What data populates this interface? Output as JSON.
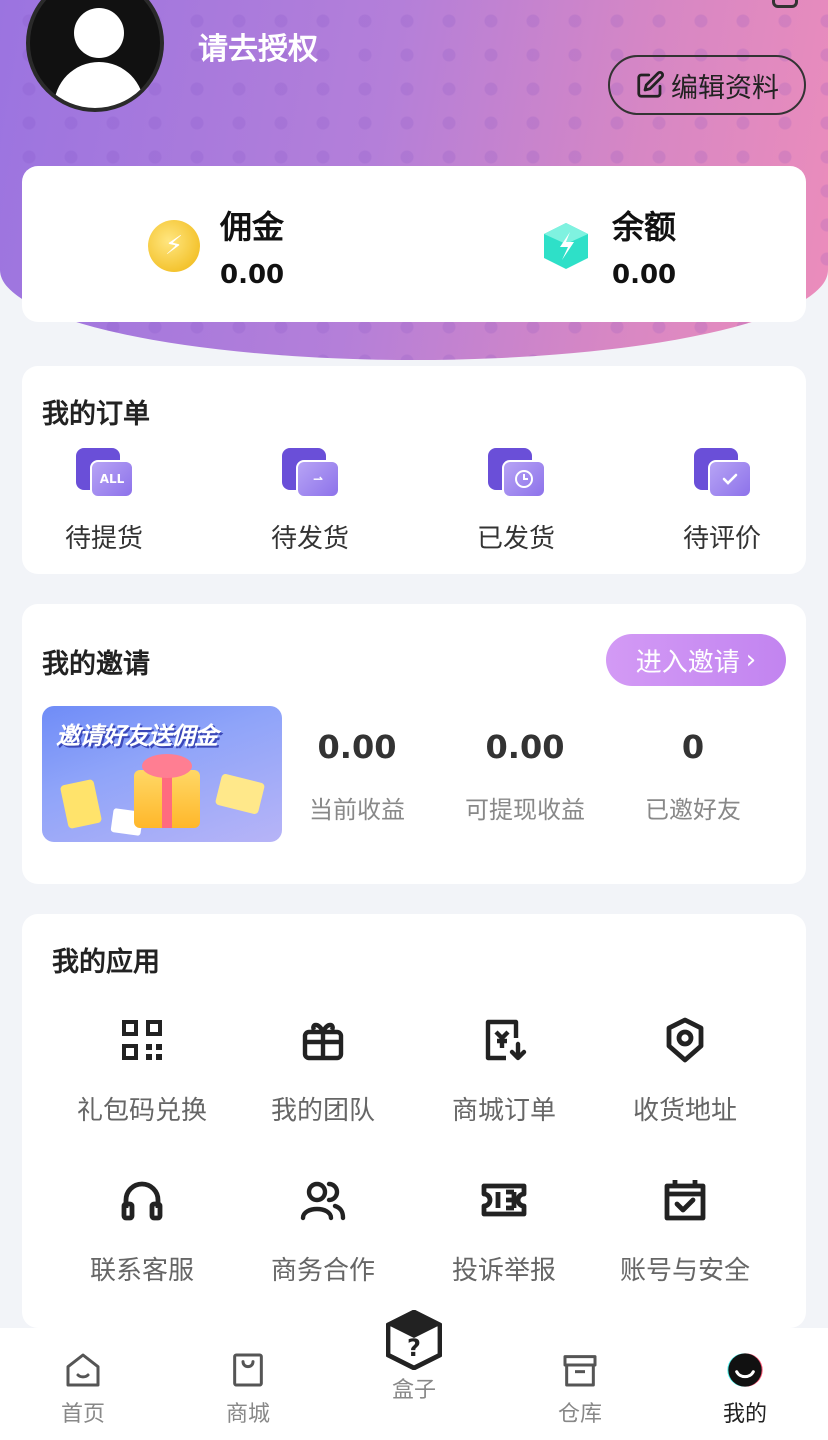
{
  "profile": {
    "auth_text": "请去授权",
    "edit_label": "编辑资料"
  },
  "wallet": {
    "commission_label": "佣金",
    "commission_value": "0.00",
    "balance_label": "余额",
    "balance_value": "0.00"
  },
  "orders": {
    "title": "我的订单",
    "items": [
      {
        "label": "待提货",
        "badge": "ALL"
      },
      {
        "label": "待发货"
      },
      {
        "label": "已发货"
      },
      {
        "label": "待评价"
      }
    ]
  },
  "invite": {
    "title": "我的邀请",
    "button_label": "进入邀请",
    "banner_title": "邀请好友送佣金",
    "stats": [
      {
        "value": "0.00",
        "label": "当前收益"
      },
      {
        "value": "0.00",
        "label": "可提现收益"
      },
      {
        "value": "0",
        "label": "已邀好友"
      }
    ]
  },
  "apps": {
    "title": "我的应用",
    "items": [
      {
        "label": "礼包码兑换",
        "icon": "qr-code-icon"
      },
      {
        "label": "我的团队",
        "icon": "gift-icon"
      },
      {
        "label": "商城订单",
        "icon": "order-invoice-icon"
      },
      {
        "label": "收货地址",
        "icon": "location-pin-icon"
      },
      {
        "label": "联系客服",
        "icon": "headset-icon"
      },
      {
        "label": "商务合作",
        "icon": "users-icon"
      },
      {
        "label": "投诉举报",
        "icon": "ticket-icon"
      },
      {
        "label": "账号与安全",
        "icon": "calendar-check-icon"
      }
    ]
  },
  "tabbar": {
    "items": [
      {
        "label": "首页",
        "icon": "home-icon"
      },
      {
        "label": "商城",
        "icon": "shopping-bag-icon"
      },
      {
        "label": "盒子",
        "icon": "mystery-box-icon"
      },
      {
        "label": "仓库",
        "icon": "warehouse-icon"
      },
      {
        "label": "我的",
        "icon": "profile-face-icon",
        "active": true
      }
    ]
  },
  "colors": {
    "accent_purple": "#6a4fd8",
    "invite_button": "#c88cf2",
    "coin_yellow": "#f4c430",
    "gem_teal": "#2ee0c8"
  }
}
